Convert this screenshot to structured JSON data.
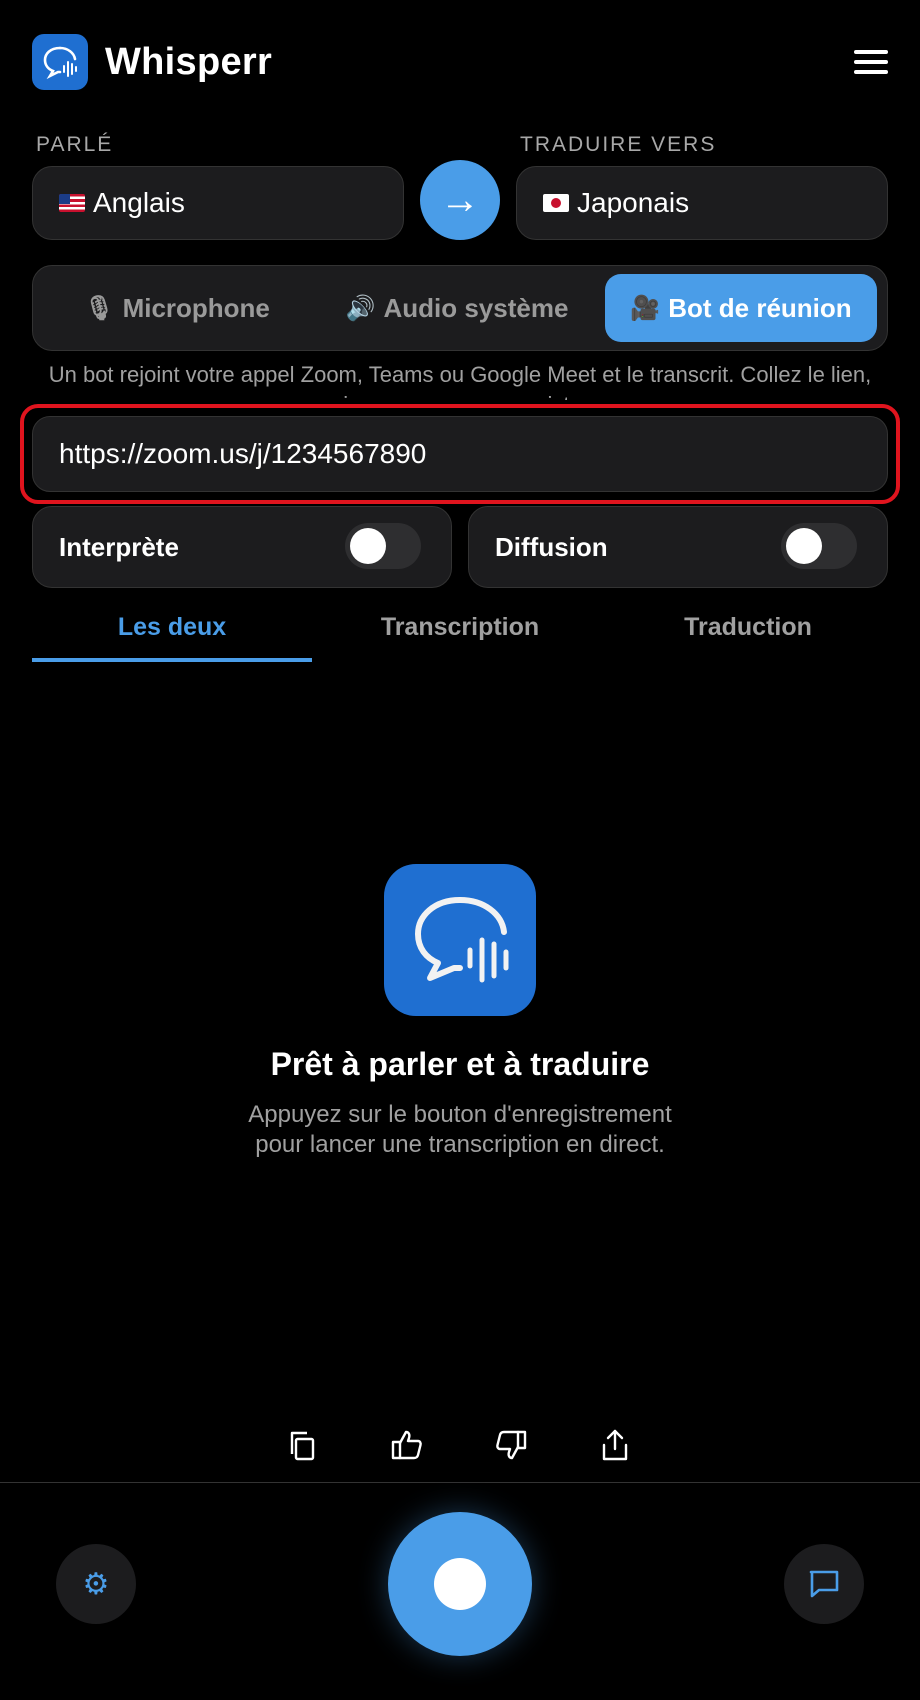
{
  "app": {
    "title": "Whisperr"
  },
  "languages": {
    "source_label": "PARLÉ",
    "source_value": "Anglais",
    "target_label": "TRADUIRE VERS",
    "target_value": "Japonais",
    "swap_glyph": "→"
  },
  "modes": [
    {
      "label": "Microphone",
      "icon": "microphone-icon",
      "glyph": "🎙",
      "active": false
    },
    {
      "label": "Audio système",
      "icon": "speaker-icon",
      "glyph": "🔊",
      "active": false
    },
    {
      "label": "Bot de réunion",
      "icon": "video-camera-icon",
      "glyph": "🎥",
      "active": true
    }
  ],
  "helper_text": "Un bot rejoint votre appel Zoom, Teams ou Google Meet et le transcrit. Collez le lien, puis appuyez sur enregistrer.",
  "meeting_url": {
    "value": "https://zoom.us/j/1234567890"
  },
  "toggles": [
    {
      "label": "Interprète",
      "on": false
    },
    {
      "label": "Diffusion",
      "on": false
    }
  ],
  "tabs": [
    {
      "label": "Les deux",
      "active": true
    },
    {
      "label": "Transcription",
      "active": false
    },
    {
      "label": "Traduction",
      "active": false
    }
  ],
  "empty_state": {
    "title": "Prêt à parler et à traduire",
    "description": "Appuyez sur le bouton d'enregistrement pour lancer une transcription en direct."
  },
  "action_icons": [
    "copy-icon",
    "thumbs-up-icon",
    "thumbs-down-icon",
    "share-icon"
  ],
  "bottom_bar": {
    "settings_glyph": "⚙"
  },
  "colors": {
    "accent": "#4a9de8",
    "brand": "#1f6fd1",
    "highlight": "#e0141e",
    "surface": "#1c1c1e"
  }
}
